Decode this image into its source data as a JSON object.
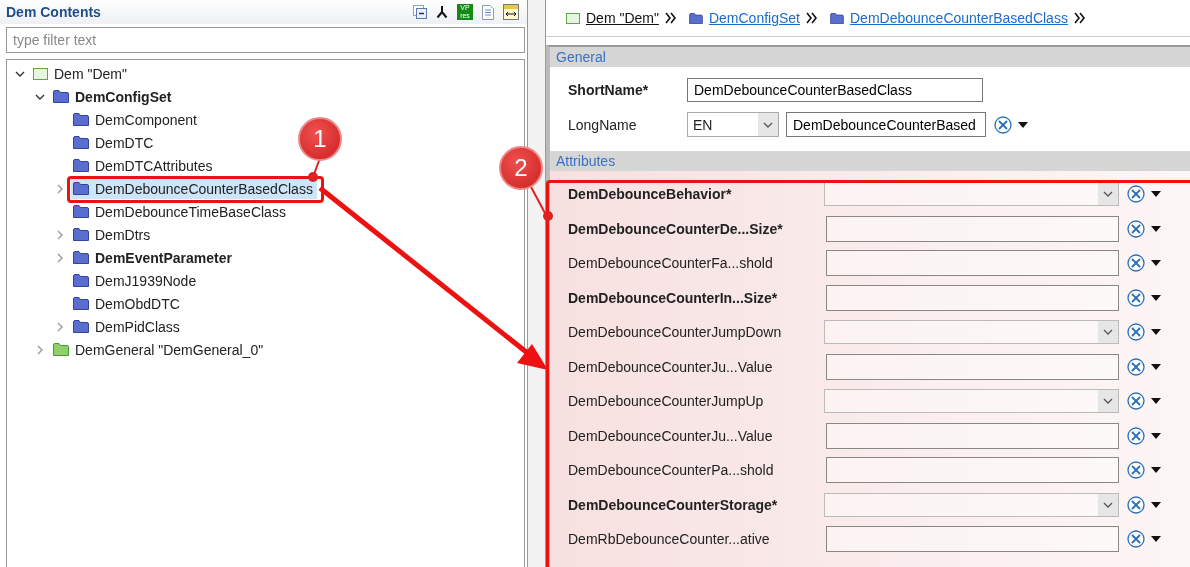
{
  "left_pane": {
    "title": "Dem Contents",
    "toolbar": [
      {
        "kind": "collapse"
      },
      {
        "kind": "fork"
      },
      {
        "kind": "badge",
        "label_top": "VP",
        "label_bottom": "res"
      },
      {
        "kind": "document"
      },
      {
        "kind": "columns"
      }
    ],
    "filter": {
      "placeholder": "type filter text"
    },
    "tree": [
      {
        "label": "Dem \"Dem\"",
        "kind": "module",
        "bold": false,
        "expandable": true,
        "expanded": true,
        "selected": false,
        "children": [
          {
            "label": "DemConfigSet",
            "kind": "folder",
            "bold": true,
            "expandable": true,
            "expanded": true,
            "selected": false,
            "children": [
              {
                "label": "DemComponent",
                "kind": "folder",
                "bold": false,
                "expandable": false,
                "selected": false
              },
              {
                "label": "DemDTC",
                "kind": "folder",
                "bold": false,
                "expandable": false,
                "selected": false
              },
              {
                "label": "DemDTCAttributes",
                "kind": "folder",
                "bold": false,
                "expandable": false,
                "selected": false
              },
              {
                "label": "DemDebounceCounterBasedClass",
                "kind": "folder",
                "bold": false,
                "expandable": true,
                "expanded": false,
                "selected": true
              },
              {
                "label": "DemDebounceTimeBaseClass",
                "kind": "folder",
                "bold": false,
                "expandable": false,
                "selected": false
              },
              {
                "label": "DemDtrs",
                "kind": "folder",
                "bold": false,
                "expandable": true,
                "expanded": false,
                "selected": false
              },
              {
                "label": "DemEventParameter",
                "kind": "folder",
                "bold": true,
                "expandable": true,
                "expanded": false,
                "selected": false
              },
              {
                "label": "DemJ1939Node",
                "kind": "folder",
                "bold": false,
                "expandable": false,
                "selected": false
              },
              {
                "label": "DemObdDTC",
                "kind": "folder",
                "bold": false,
                "expandable": false,
                "selected": false
              },
              {
                "label": "DemPidClass",
                "kind": "folder",
                "bold": false,
                "expandable": true,
                "expanded": false,
                "selected": false
              }
            ]
          },
          {
            "label": "DemGeneral \"DemGeneral_0\"",
            "kind": "general-folder",
            "bold": false,
            "expandable": true,
            "expanded": false,
            "selected": false
          }
        ]
      }
    ]
  },
  "breadcrumb": [
    {
      "label": "Dem \"Dem\"",
      "kind": "module",
      "link": false
    },
    {
      "label": "DemConfigSet",
      "kind": "folder",
      "link": true
    },
    {
      "label": "DemDebounceCounterBasedClass",
      "kind": "folder",
      "link": true
    }
  ],
  "general": {
    "title": "General",
    "short_name": {
      "label": "ShortName*",
      "value": "DemDebounceCounterBasedClass"
    },
    "long_name": {
      "label": "LongName",
      "language": "EN",
      "value": "DemDebounceCounterBased"
    }
  },
  "attributes": {
    "title": "Attributes",
    "rows": [
      {
        "label": "DemDebounceBehavior*",
        "required": true,
        "kind": "select"
      },
      {
        "label": "DemDebounceCounterDe...Size*",
        "required": true,
        "kind": "text"
      },
      {
        "label": "DemDebounceCounterFa...shold",
        "required": false,
        "kind": "text"
      },
      {
        "label": "DemDebounceCounterIn...Size*",
        "required": true,
        "kind": "text"
      },
      {
        "label": "DemDebounceCounterJumpDown",
        "required": false,
        "kind": "select"
      },
      {
        "label": "DemDebounceCounterJu...Value",
        "required": false,
        "kind": "text"
      },
      {
        "label": "DemDebounceCounterJumpUp",
        "required": false,
        "kind": "select"
      },
      {
        "label": "DemDebounceCounterJu...Value",
        "required": false,
        "kind": "text"
      },
      {
        "label": "DemDebounceCounterPa...shold",
        "required": false,
        "kind": "text"
      },
      {
        "label": "DemDebounceCounterStorage*",
        "required": true,
        "kind": "select"
      },
      {
        "label": "DemRbDebounceCounter...ative",
        "required": false,
        "kind": "text"
      }
    ]
  },
  "annotations": [
    {
      "number": "1"
    },
    {
      "number": "2"
    }
  ]
}
